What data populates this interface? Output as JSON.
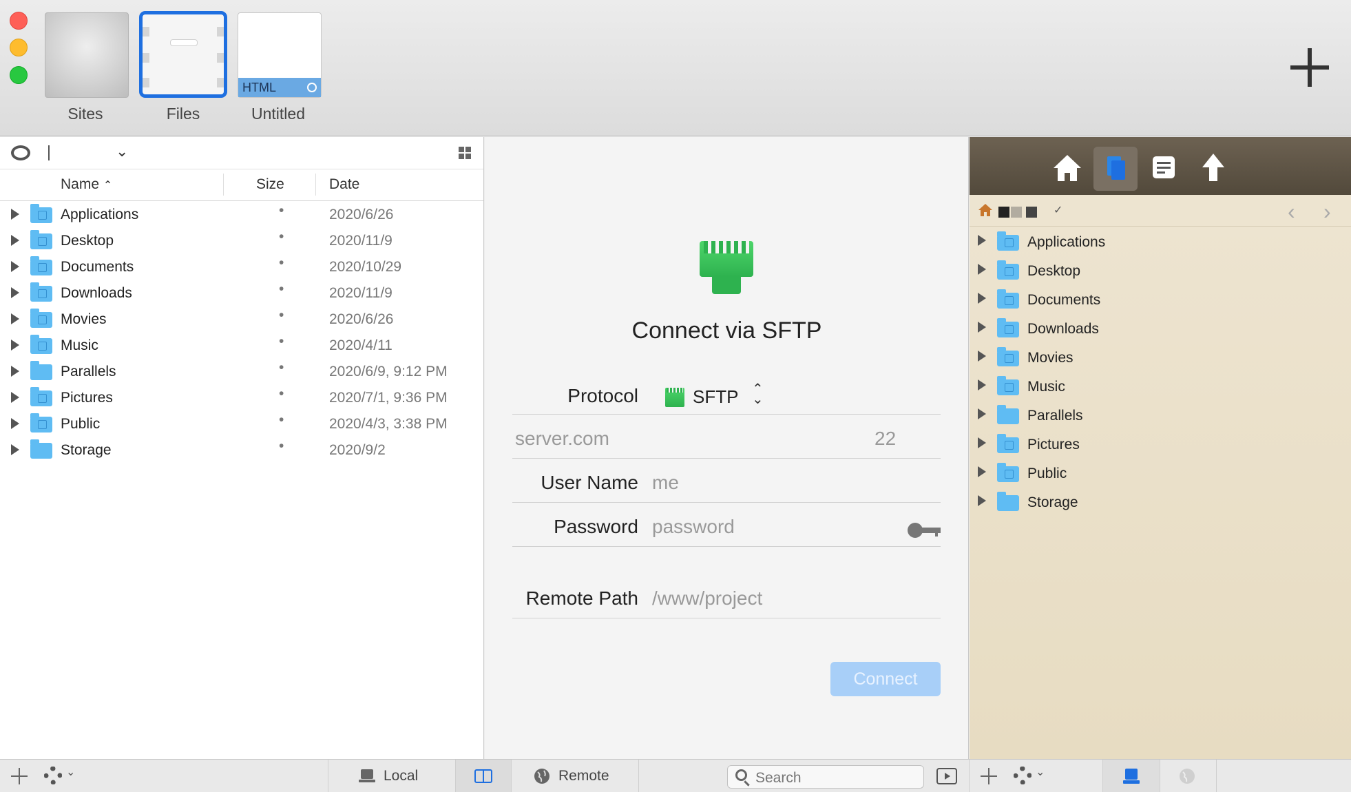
{
  "tabs": [
    {
      "label": "Sites"
    },
    {
      "label": "Files"
    },
    {
      "label": "Untitled",
      "badge": "HTML"
    }
  ],
  "local_browser": {
    "columns": {
      "name": "Name",
      "size": "Size",
      "date": "Date"
    },
    "rows": [
      {
        "name": "Applications",
        "size": "•",
        "date": "2020/6/26",
        "icon": "applications-folder-icon"
      },
      {
        "name": "Desktop",
        "size": "•",
        "date": "2020/11/9",
        "icon": "desktop-folder-icon"
      },
      {
        "name": "Documents",
        "size": "•",
        "date": "2020/10/29",
        "icon": "documents-folder-icon"
      },
      {
        "name": "Downloads",
        "size": "•",
        "date": "2020/11/9",
        "icon": "downloads-folder-icon"
      },
      {
        "name": "Movies",
        "size": "•",
        "date": "2020/6/26",
        "icon": "movies-folder-icon"
      },
      {
        "name": "Music",
        "size": "•",
        "date": "2020/4/11",
        "icon": "music-folder-icon"
      },
      {
        "name": "Parallels",
        "size": "•",
        "date": "2020/6/9, 9:12 PM",
        "icon": "folder-icon"
      },
      {
        "name": "Pictures",
        "size": "•",
        "date": "2020/7/1, 9:36 PM",
        "icon": "pictures-folder-icon"
      },
      {
        "name": "Public",
        "size": "•",
        "date": "2020/4/3, 3:38 PM",
        "icon": "public-folder-icon"
      },
      {
        "name": "Storage",
        "size": "•",
        "date": "2020/9/2",
        "icon": "folder-icon"
      }
    ]
  },
  "connect": {
    "title": "Connect via SFTP",
    "protocol_label": "Protocol",
    "protocol_value": "SFTP",
    "server_placeholder": "server.com",
    "port_placeholder": "22",
    "username_label": "User Name",
    "username_placeholder": "me",
    "password_label": "Password",
    "password_placeholder": "password",
    "remote_path_label": "Remote Path",
    "remote_path_placeholder": "/www/project",
    "connect_button": "Connect"
  },
  "remote_browser": {
    "rows": [
      {
        "name": "Applications"
      },
      {
        "name": "Desktop"
      },
      {
        "name": "Documents"
      },
      {
        "name": "Downloads"
      },
      {
        "name": "Movies"
      },
      {
        "name": "Music"
      },
      {
        "name": "Parallels"
      },
      {
        "name": "Pictures"
      },
      {
        "name": "Public"
      },
      {
        "name": "Storage"
      }
    ]
  },
  "statusbar": {
    "local_label": "Local",
    "remote_label": "Remote",
    "search_placeholder": "Search"
  },
  "colors": {
    "accent": "#1e6fe0",
    "folder": "#5fbcf3",
    "connect_button": "#a8cff8",
    "sftp_green": "#2eb24f",
    "remote_toolbar": "#5d5345"
  }
}
